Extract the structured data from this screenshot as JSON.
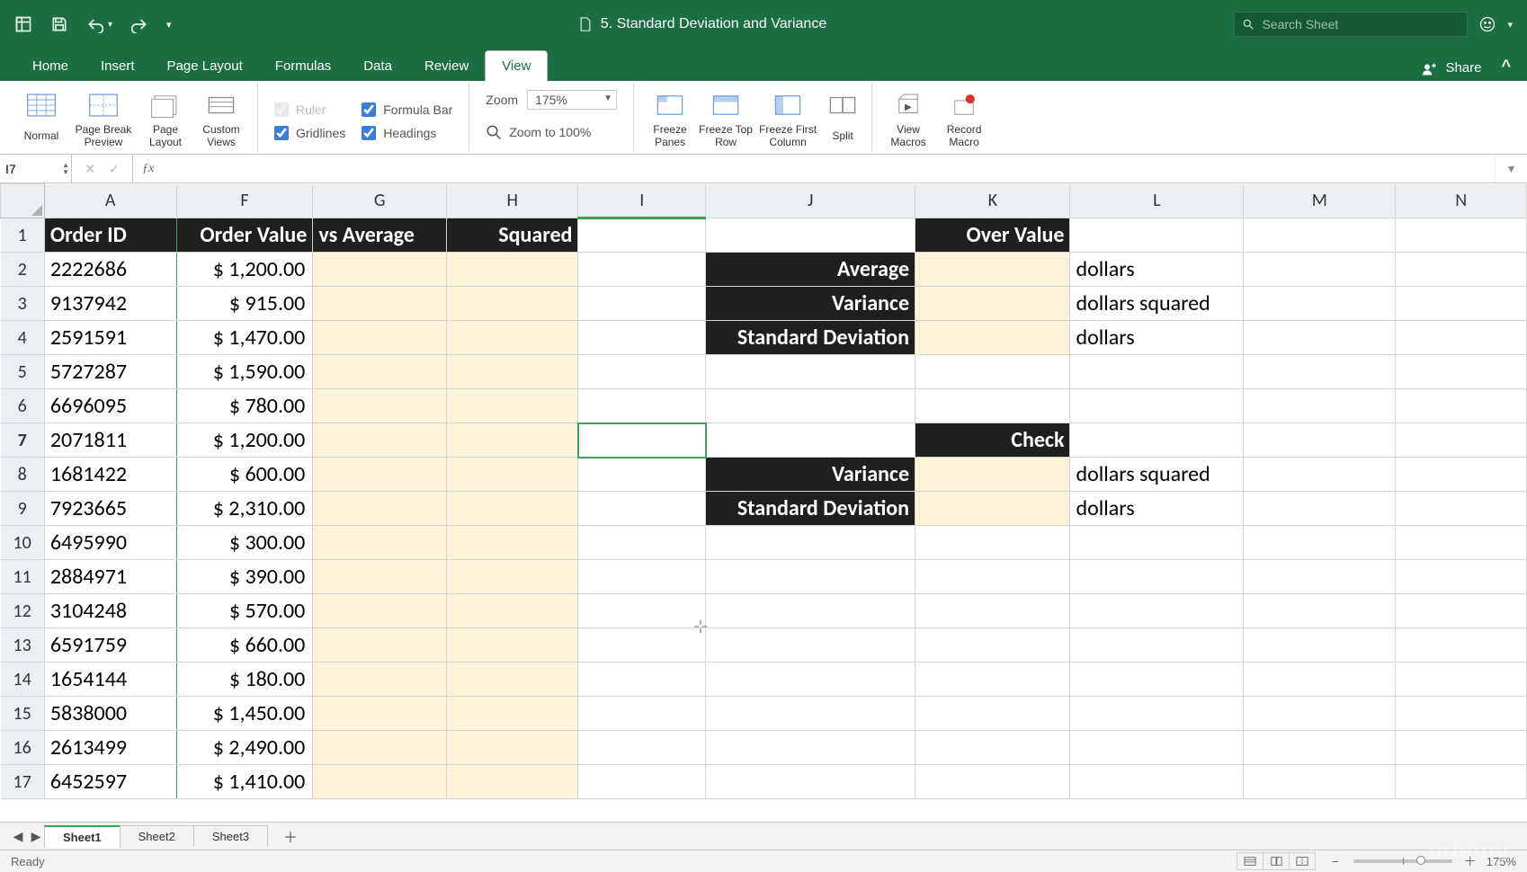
{
  "chart_data": {
    "type": "table",
    "title": "5. Standard Deviation and Variance",
    "columns": [
      "Order ID",
      "Order Value",
      "vs Average",
      "Squared"
    ],
    "rows": [
      {
        "order_id": "2222686",
        "order_value": 1200.0
      },
      {
        "order_id": "9137942",
        "order_value": 915.0
      },
      {
        "order_id": "2591591",
        "order_value": 1470.0
      },
      {
        "order_id": "5727287",
        "order_value": 1590.0
      },
      {
        "order_id": "6696095",
        "order_value": 780.0
      },
      {
        "order_id": "2071811",
        "order_value": 1200.0
      },
      {
        "order_id": "1681422",
        "order_value": 600.0
      },
      {
        "order_id": "7923665",
        "order_value": 2310.0
      },
      {
        "order_id": "6495990",
        "order_value": 300.0
      },
      {
        "order_id": "2884971",
        "order_value": 390.0
      },
      {
        "order_id": "3104248",
        "order_value": 570.0
      },
      {
        "order_id": "6591759",
        "order_value": 660.0
      },
      {
        "order_id": "1654144",
        "order_value": 180.0
      },
      {
        "order_id": "5838000",
        "order_value": 1450.0
      },
      {
        "order_id": "2613499",
        "order_value": 2490.0
      },
      {
        "order_id": "6452597",
        "order_value": 1410.0
      }
    ],
    "stats_block": {
      "over_value_header": "Over Value",
      "rows": [
        {
          "label": "Average",
          "unit": "dollars"
        },
        {
          "label": "Variance",
          "unit": "dollars squared"
        },
        {
          "label": "Standard Deviation",
          "unit": "dollars"
        }
      ]
    },
    "check_block": {
      "header": "Check",
      "rows": [
        {
          "label": "Variance",
          "unit": "dollars squared"
        },
        {
          "label": "Standard Deviation",
          "unit": "dollars"
        }
      ]
    }
  },
  "titlebar": {
    "doc_title": "5. Standard Deviation and Variance",
    "search_placeholder": "Search Sheet"
  },
  "tabs": {
    "items": [
      "Home",
      "Insert",
      "Page Layout",
      "Formulas",
      "Data",
      "Review",
      "View"
    ],
    "active_index": 6,
    "share": "Share"
  },
  "ribbon": {
    "views": [
      "Normal",
      "Page Break Preview",
      "Page Layout",
      "Custom Views"
    ],
    "checks": {
      "ruler": "Ruler",
      "formula": "Formula Bar",
      "gridlines": "Gridlines",
      "headings": "Headings"
    },
    "zoom_label": "Zoom",
    "zoom_value": "175%",
    "zoomfit": "Zoom to 100%",
    "freeze": [
      "Freeze Panes",
      "Freeze Top Row",
      "Freeze First Column",
      "Split"
    ],
    "macros": [
      "View Macros",
      "Record Macro"
    ]
  },
  "fx": {
    "name_box": "I7",
    "formula": ""
  },
  "columns": [
    "A",
    "F",
    "G",
    "H",
    "I",
    "J",
    "K",
    "L",
    "M",
    "N"
  ],
  "col_widths": {
    "A": 152,
    "F": 154,
    "G": 152,
    "H": 152,
    "I": 156,
    "J": 236,
    "K": 178,
    "L": 196,
    "M": 186,
    "N": 160
  },
  "headers": {
    "A": "Order ID",
    "F": "Order Value",
    "G": "vs Average",
    "H": "Squared",
    "K": "Over Value"
  },
  "labels": {
    "J2": "Average",
    "L2": "dollars",
    "J3": "Variance",
    "L3": "dollars squared",
    "J4": "Standard Deviation",
    "L4": "dollars",
    "K7": "Check",
    "J8": "Variance",
    "L8": "dollars squared",
    "J9": "Standard Deviation",
    "L9": "dollars"
  },
  "rows": [
    {
      "n": "1"
    },
    {
      "n": "2",
      "A": "2222686",
      "F": "$   1,200.00"
    },
    {
      "n": "3",
      "A": "9137942",
      "F": "$      915.00"
    },
    {
      "n": "4",
      "A": "2591591",
      "F": "$   1,470.00"
    },
    {
      "n": "5",
      "A": "5727287",
      "F": "$   1,590.00"
    },
    {
      "n": "6",
      "A": "6696095",
      "F": "$      780.00"
    },
    {
      "n": "7",
      "A": "2071811",
      "F": "$   1,200.00"
    },
    {
      "n": "8",
      "A": "1681422",
      "F": "$      600.00"
    },
    {
      "n": "9",
      "A": "7923665",
      "F": "$   2,310.00"
    },
    {
      "n": "10",
      "A": "6495990",
      "F": "$      300.00"
    },
    {
      "n": "11",
      "A": "2884971",
      "F": "$      390.00"
    },
    {
      "n": "12",
      "A": "3104248",
      "F": "$      570.00"
    },
    {
      "n": "13",
      "A": "6591759",
      "F": "$      660.00"
    },
    {
      "n": "14",
      "A": "1654144",
      "F": "$      180.00"
    },
    {
      "n": "15",
      "A": "5838000",
      "F": "$   1,450.00"
    },
    {
      "n": "16",
      "A": "2613499",
      "F": "$   2,490.00"
    },
    {
      "n": "17",
      "A": "6452597",
      "F": "$   1,410.00"
    }
  ],
  "active_cell": {
    "col": "I",
    "row": 7
  },
  "sheets": {
    "items": [
      "Sheet1",
      "Sheet2",
      "Sheet3"
    ],
    "active_index": 0
  },
  "status": {
    "text": "Ready",
    "zoom": "175%"
  }
}
